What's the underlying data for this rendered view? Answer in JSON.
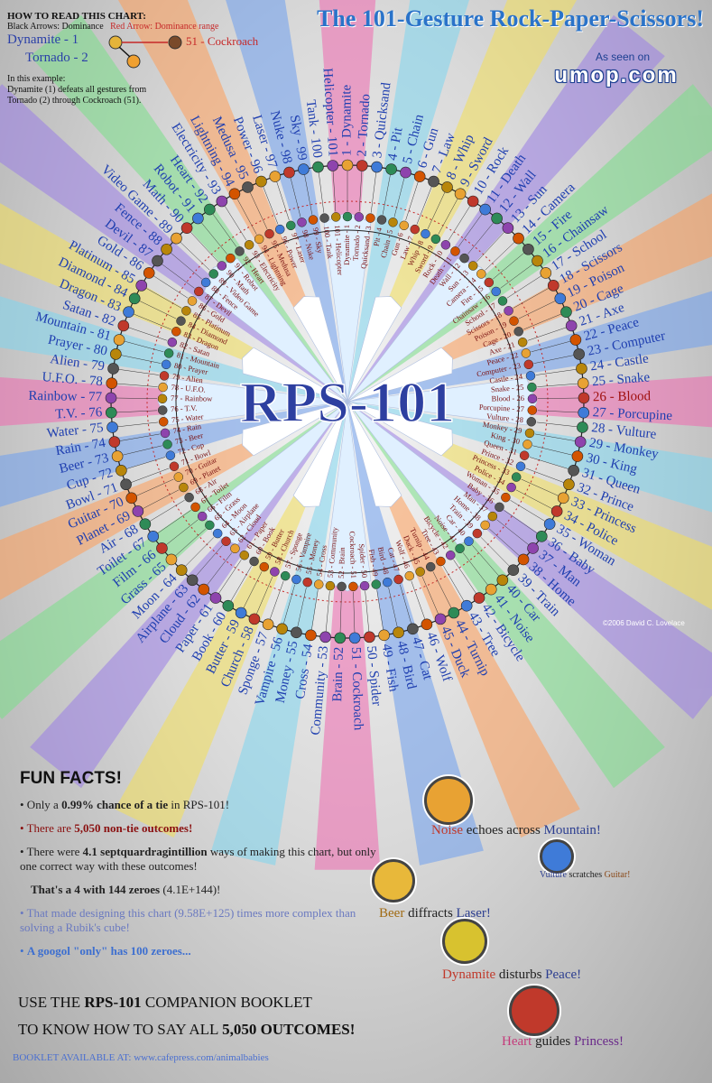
{
  "howto": {
    "heading": "HOW TO READ THIS CHART:",
    "legend_black": "Black Arrows: Dominance",
    "legend_red": "Red Arrow: Dominance range",
    "ex_dynamite": "Dynamite - 1",
    "ex_tornado": "Tornado - 2",
    "ex_cockroach": "51 - Cockroach",
    "example_label": "In this example:",
    "example_text_1": "Dynamite (1) defeats all gestures from",
    "example_text_2": "Tornado (2) through Cockroach (51)."
  },
  "title": "The 101-Gesture Rock-Paper-Scissors!",
  "seen_on": "As seen on",
  "site": "umop.com",
  "center_logo": "RPS-101",
  "copyright": "©2006 David C. Lovelace",
  "gestures": [
    "Dynamite",
    "Tornado",
    "Quicksand",
    "Pit",
    "Chain",
    "Gun",
    "Law",
    "Whip",
    "Sword",
    "Rock",
    "Death",
    "Wall",
    "Sun",
    "Camera",
    "Fire",
    "Chainsaw",
    "School",
    "Scissors",
    "Poison",
    "Cage",
    "Axe",
    "Peace",
    "Computer",
    "Castle",
    "Snake",
    "Blood",
    "Porcupine",
    "Vulture",
    "Monkey",
    "King",
    "Queen",
    "Prince",
    "Princess",
    "Police",
    "Woman",
    "Baby",
    "Man",
    "Home",
    "Train",
    "Car",
    "Noise",
    "Bicycle",
    "Tree",
    "Turnip",
    "Duck",
    "Wolf",
    "Cat",
    "Bird",
    "Fish",
    "Spider",
    "Cockroach",
    "Brain",
    "Community",
    "Cross",
    "Money",
    "Vampire",
    "Sponge",
    "Church",
    "Butter",
    "Book",
    "Paper",
    "Cloud",
    "Airplane",
    "Moon",
    "Grass",
    "Film",
    "Toilet",
    "Air",
    "Planet",
    "Guitar",
    "Bowl",
    "Cup",
    "Beer",
    "Rain",
    "Water",
    "T.V.",
    "Rainbow",
    "U.F.O.",
    "Alien",
    "Prayer",
    "Mountain",
    "Satan",
    "Dragon",
    "Diamond",
    "Platinum",
    "Gold",
    "Devil",
    "Fence",
    "Video Game",
    "Math",
    "Robot",
    "Heart",
    "Electricity",
    "Lightning",
    "Medusa",
    "Power",
    "Laser",
    "Nuke",
    "Sky",
    "Tank",
    "Helicopter"
  ],
  "facts": {
    "heading": "FUN FACTS!",
    "items": [
      {
        "pre": "Only a ",
        "bold": "0.99% chance of a tie",
        "post": " in RPS-101!",
        "color": "#222"
      },
      {
        "pre": "There are ",
        "bold": "5,050 non-tie outcomes!",
        "post": "",
        "color": "#8a1010"
      },
      {
        "pre": "There were ",
        "bold": "4.1 septquardragintillion",
        "post": " ways of making this chart, but only one correct way with these outcomes!",
        "color": "#222"
      },
      {
        "pre": "",
        "bold": "That's a 4 with 144 zeroes",
        "post": " (4.1E+144)!",
        "color": "#222"
      },
      {
        "pre": "That made designing this chart (9.58E+125) times more complex than solving a Rubik's cube!",
        "bold": "",
        "post": "",
        "color": "#6a79c0"
      },
      {
        "pre": "",
        "bold": "A googol \"only\" has 100 zeroes...",
        "post": "",
        "color": "#3d6fd0"
      }
    ]
  },
  "cta_line1_a": "USE THE ",
  "cta_line1_b": "RPS-101",
  "cta_line1_c": " COMPANION BOOKLET",
  "cta_line2_a": "TO KNOW HOW TO SAY ALL ",
  "cta_line2_b": "5,050 OUTCOMES!",
  "booklet": "BOOKLET AVAILABLE AT: www.cafepress.com/animalbabies",
  "outcomes": [
    {
      "a": "Noise",
      "verb": "echoes across",
      "b": "Mountain!",
      "ca": "#c0392b",
      "cb": "#2c3e90",
      "bg": "#e8a233"
    },
    {
      "a": "Beer",
      "verb": "diffracts",
      "b": "Laser!",
      "ca": "#a06a12",
      "cb": "#2c3e90",
      "bg": "#e8b83a"
    },
    {
      "a": "Vulture",
      "verb": "scratches",
      "b": "Guitar!",
      "ca": "#2c3e90",
      "cb": "#8a4a1a",
      "bg": "#3f7bd8"
    },
    {
      "a": "Dynamite",
      "verb": "disturbs",
      "b": "Peace!",
      "ca": "#c0392b",
      "cb": "#2c3e90",
      "bg": "#d8c22f"
    },
    {
      "a": "Heart",
      "verb": "guides",
      "b": "Princess!",
      "ca": "#c43a7a",
      "cb": "#6a2a8a",
      "bg": "#c0392b"
    }
  ],
  "colors": {
    "title": "#2a73c9",
    "ring_red": "#c62828",
    "label_blue": "#1f3fb0"
  }
}
